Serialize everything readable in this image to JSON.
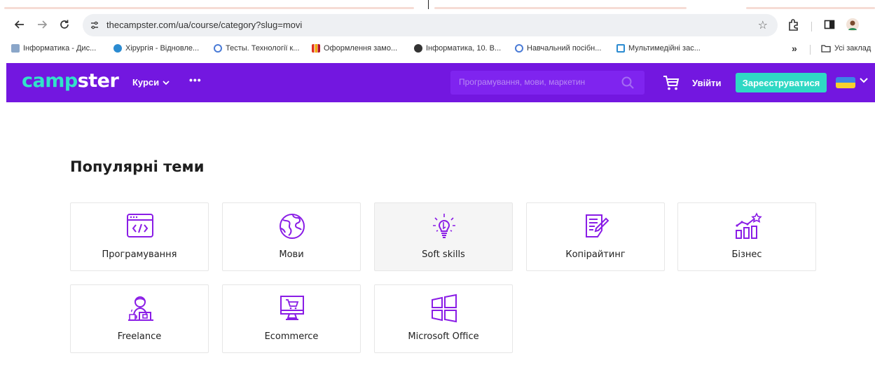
{
  "browser": {
    "url": "thecampster.com/ua/course/category?slug=movi",
    "bookmarks": [
      {
        "label": "Інформатика - Дис...",
        "color": "#8aa6c9"
      },
      {
        "label": "Хірургія - Відновле...",
        "color": "#2b8bd1"
      },
      {
        "label": "Тесты. Технології к...",
        "color": "#4a7bd6"
      },
      {
        "label": "Оформлення замо...",
        "color": "#e0301e"
      },
      {
        "label": "Інформатика, 10. В...",
        "color": "#333333"
      },
      {
        "label": "Навчальний посібн...",
        "color": "#4a7bd6"
      },
      {
        "label": "Мультимедійні зас...",
        "color": "#2b8bd1"
      }
    ],
    "bookmarks_more": "»",
    "all_bookmarks": "Усі заклад"
  },
  "header": {
    "logo_part1": "camp",
    "logo_part2": "ster",
    "courses": "Курси",
    "more": "•••",
    "search_placeholder": "Програмування, мови, маркетин",
    "login": "Увійти",
    "register": "Зареєструватися"
  },
  "section": {
    "title": "Популярні теми"
  },
  "topics": [
    {
      "label": "Програмування",
      "icon": "code-window-icon"
    },
    {
      "label": "Мови",
      "icon": "globe-icon"
    },
    {
      "label": "Soft skills",
      "icon": "lightbulb-icon"
    },
    {
      "label": "Копірайтинг",
      "icon": "document-pen-icon"
    },
    {
      "label": "Бізнес",
      "icon": "growth-chart-icon"
    },
    {
      "label": "Freelance",
      "icon": "freelancer-icon"
    },
    {
      "label": "Ecommerce",
      "icon": "shopping-monitor-icon"
    },
    {
      "label": "Microsoft Office",
      "icon": "windows-logo-icon"
    }
  ],
  "colors": {
    "brand_purple": "#7317e0",
    "accent_teal": "#2fd8c4",
    "icon_purple": "#8a1de6"
  }
}
